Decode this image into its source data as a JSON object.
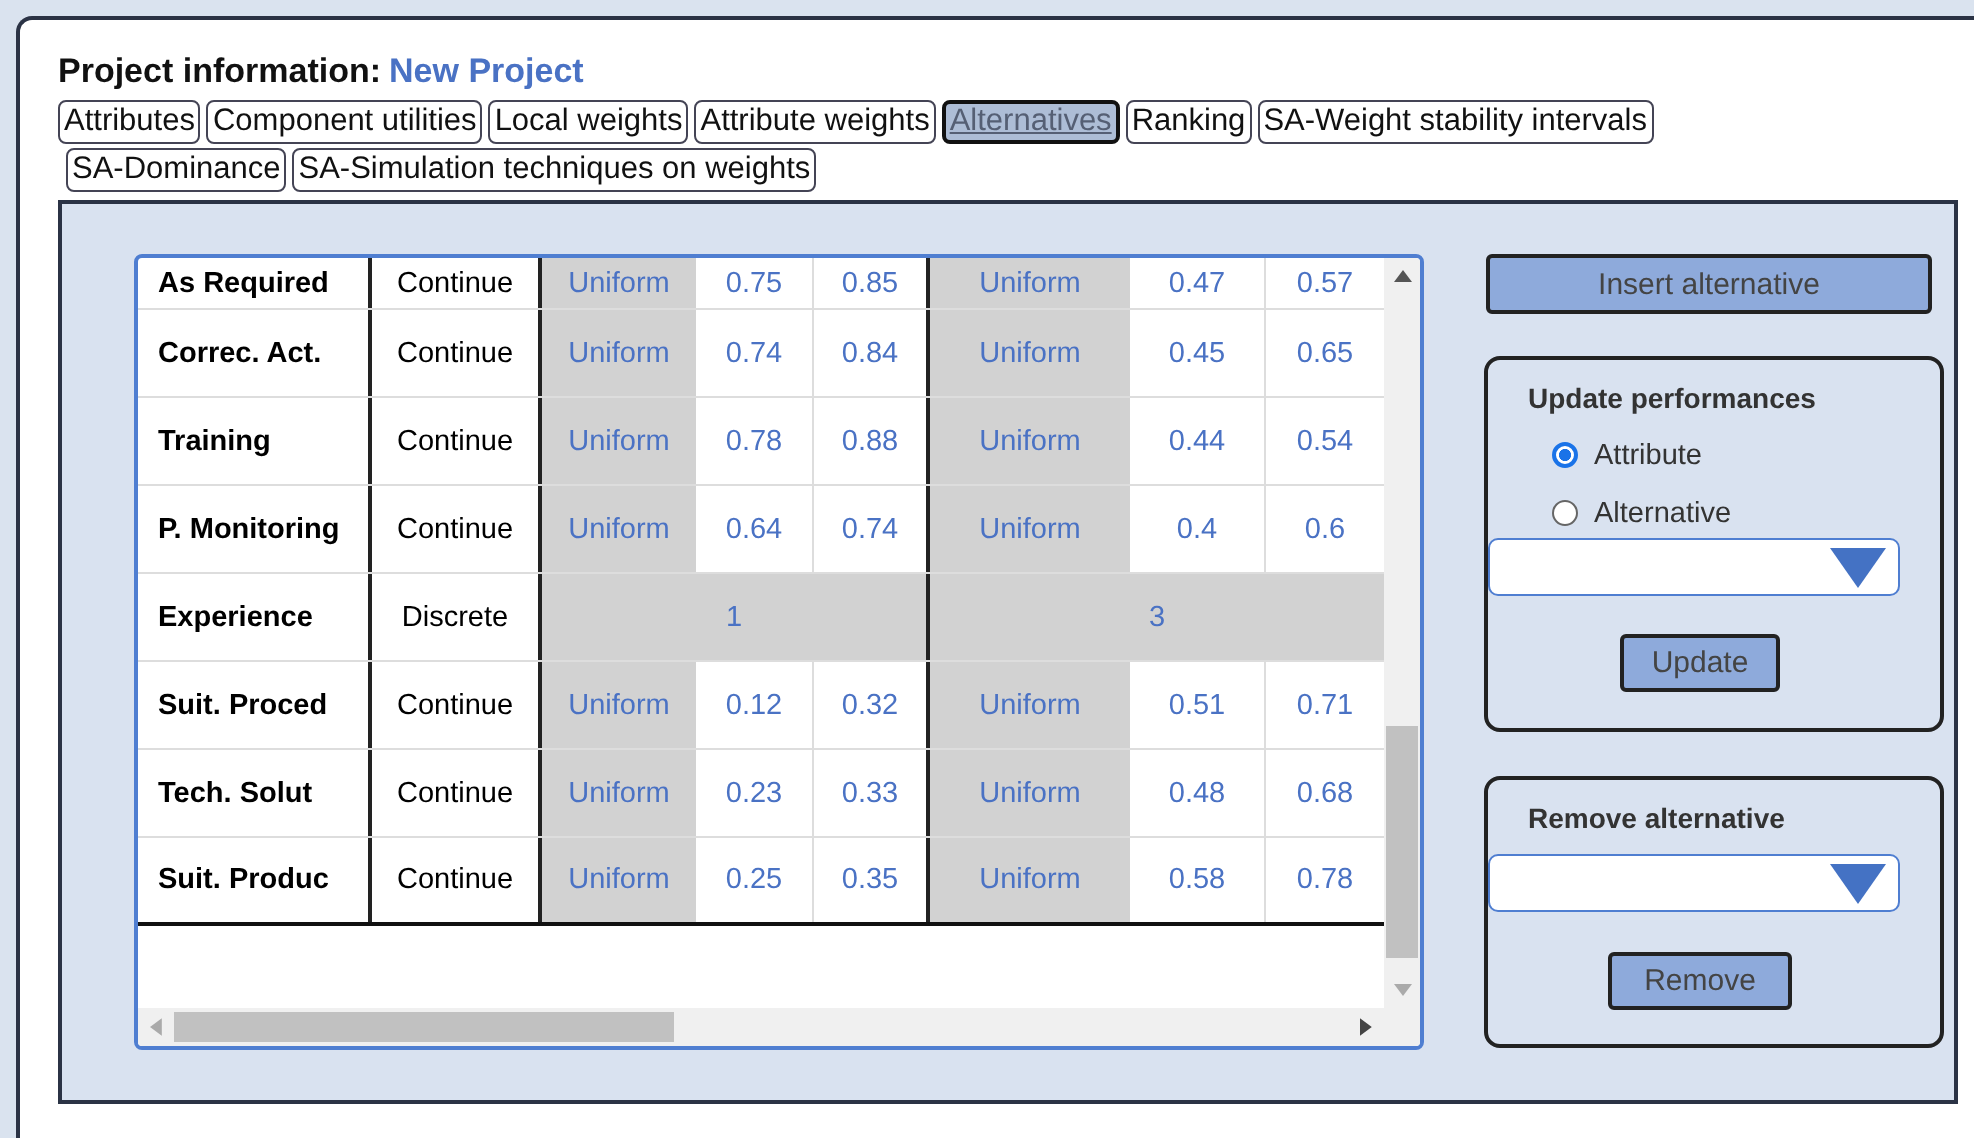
{
  "project": {
    "label": "Project information:",
    "name": "New Project"
  },
  "tabs": [
    {
      "label": "Attributes",
      "selected": false
    },
    {
      "label": "Component utilities",
      "selected": false
    },
    {
      "label": "Local weights",
      "selected": false
    },
    {
      "label": "Attribute weights",
      "selected": false
    },
    {
      "label": "Alternatives",
      "selected": true
    },
    {
      "label": "Ranking",
      "selected": false
    },
    {
      "label": "SA-Weight stability intervals",
      "selected": false
    },
    {
      "label": "SA-Dominance",
      "selected": false
    },
    {
      "label": "SA-Simulation techniques on weights",
      "selected": false
    }
  ],
  "table": {
    "rows": [
      {
        "name": "As Required",
        "type": "Continue",
        "kind": "range",
        "values": [
          "Uniform",
          "0.75",
          "0.85",
          "Uniform",
          "0.47",
          "0.57"
        ]
      },
      {
        "name": "Correc. Act.",
        "type": "Continue",
        "kind": "range",
        "values": [
          "Uniform",
          "0.74",
          "0.84",
          "Uniform",
          "0.45",
          "0.65"
        ]
      },
      {
        "name": "Training",
        "type": "Continue",
        "kind": "range",
        "values": [
          "Uniform",
          "0.78",
          "0.88",
          "Uniform",
          "0.44",
          "0.54"
        ]
      },
      {
        "name": "P. Monitoring",
        "type": "Continue",
        "kind": "range",
        "values": [
          "Uniform",
          "0.64",
          "0.74",
          "Uniform",
          "0.4",
          "0.6"
        ]
      },
      {
        "name": "Experience",
        "type": "Discrete",
        "kind": "single",
        "values": [
          "1",
          "3"
        ]
      },
      {
        "name": "Suit. Proced",
        "type": "Continue",
        "kind": "range",
        "values": [
          "Uniform",
          "0.12",
          "0.32",
          "Uniform",
          "0.51",
          "0.71"
        ]
      },
      {
        "name": "Tech. Solut",
        "type": "Continue",
        "kind": "range",
        "values": [
          "Uniform",
          "0.23",
          "0.33",
          "Uniform",
          "0.48",
          "0.68"
        ]
      },
      {
        "name": "Suit. Produc",
        "type": "Continue",
        "kind": "range",
        "values": [
          "Uniform",
          "0.25",
          "0.35",
          "Uniform",
          "0.58",
          "0.78"
        ]
      }
    ]
  },
  "insert_button": "Insert alternative",
  "update": {
    "title": "Update performances",
    "options": [
      {
        "label": "Attribute",
        "selected": true
      },
      {
        "label": "Alternative",
        "selected": false
      }
    ],
    "button": "Update"
  },
  "remove": {
    "title": "Remove alternative",
    "button": "Remove"
  }
}
